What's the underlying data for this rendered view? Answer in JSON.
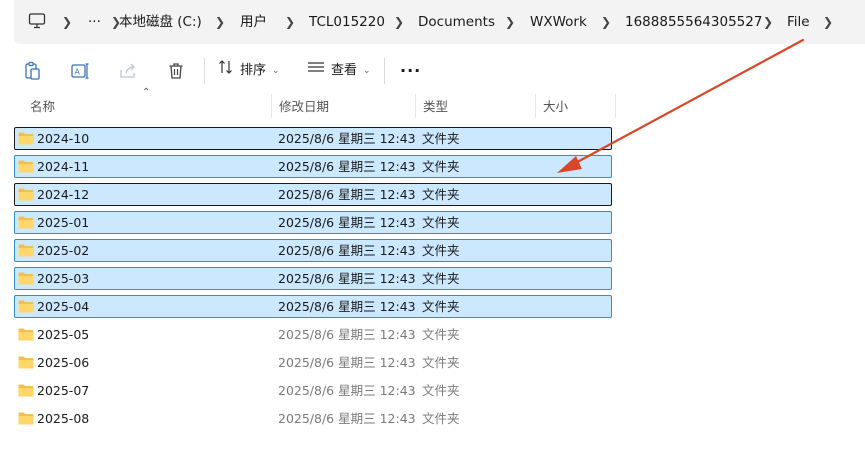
{
  "breadcrumb": {
    "more": "···",
    "items": [
      "本地磁盘 (C:)",
      "用户",
      "TCL015220",
      "Documents",
      "WXWork",
      "1688855564305527",
      "File"
    ]
  },
  "toolbar": {
    "sort_label": "排序",
    "view_label": "查看",
    "more_label": "···"
  },
  "columns": {
    "name": "名称",
    "modified": "修改日期",
    "type": "类型",
    "size": "大小"
  },
  "rows": [
    {
      "name": "2024-10",
      "modified": "2025/8/6 星期三 12:43",
      "type": "文件夹"
    },
    {
      "name": "2024-11",
      "modified": "2025/8/6 星期三 12:43",
      "type": "文件夹"
    },
    {
      "name": "2024-12",
      "modified": "2025/8/6 星期三 12:43",
      "type": "文件夹"
    },
    {
      "name": "2025-01",
      "modified": "2025/8/6 星期三 12:43",
      "type": "文件夹"
    },
    {
      "name": "2025-02",
      "modified": "2025/8/6 星期三 12:43",
      "type": "文件夹"
    },
    {
      "name": "2025-03",
      "modified": "2025/8/6 星期三 12:43",
      "type": "文件夹"
    },
    {
      "name": "2025-04",
      "modified": "2025/8/6 星期三 12:43",
      "type": "文件夹"
    },
    {
      "name": "2025-05",
      "modified": "2025/8/6 星期三 12:43",
      "type": "文件夹"
    },
    {
      "name": "2025-06",
      "modified": "2025/8/6 星期三 12:43",
      "type": "文件夹"
    },
    {
      "name": "2025-07",
      "modified": "2025/8/6 星期三 12:43",
      "type": "文件夹"
    },
    {
      "name": "2025-08",
      "modified": "2025/8/6 星期三 12:43",
      "type": "文件夹"
    }
  ],
  "colors": {
    "selection_bg": "#cce8ff",
    "selection_border": "#2f8fcf",
    "folder": "#f5c04a",
    "annotation_arrow": "#d9462a"
  }
}
